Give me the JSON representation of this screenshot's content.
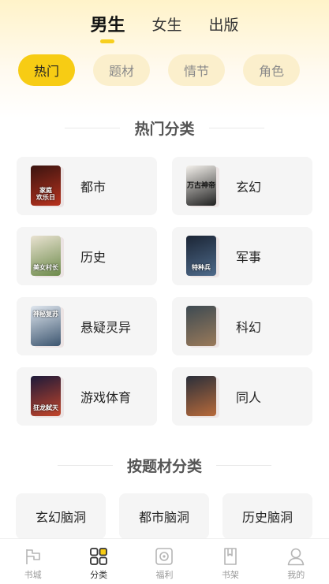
{
  "gender_tabs": [
    {
      "label": "男生",
      "active": true
    },
    {
      "label": "女生",
      "active": false
    },
    {
      "label": "出版",
      "active": false
    }
  ],
  "filter_chips": [
    {
      "label": "热门",
      "active": true
    },
    {
      "label": "题材",
      "active": false
    },
    {
      "label": "情节",
      "active": false
    },
    {
      "label": "角色",
      "active": false
    }
  ],
  "section_hot": {
    "title": "热门分类"
  },
  "categories": [
    {
      "label": "都市",
      "cover_text": "家庭\n欢乐日",
      "cover_colors": [
        "#3a1410",
        "#b8321e"
      ]
    },
    {
      "label": "玄幻",
      "cover_text": "万古神帝",
      "cover_colors": [
        "#f4f1ec",
        "#202020"
      ]
    },
    {
      "label": "历史",
      "cover_text": "美女村长",
      "cover_colors": [
        "#e9e2d1",
        "#6c8a4a"
      ]
    },
    {
      "label": "军事",
      "cover_text": "特种兵",
      "cover_colors": [
        "#1b2535",
        "#4e6a8a"
      ]
    },
    {
      "label": "悬疑灵异",
      "cover_text": "神秘复苏",
      "cover_colors": [
        "#dfe6ee",
        "#3d5670"
      ]
    },
    {
      "label": "科幻",
      "cover_text": "",
      "cover_colors": [
        "#3d4a52",
        "#9a7a5a"
      ]
    },
    {
      "label": "游戏体育",
      "cover_text": "狂龙弑天",
      "cover_colors": [
        "#1c1a3a",
        "#c4452a"
      ]
    },
    {
      "label": "同人",
      "cover_text": "",
      "cover_colors": [
        "#2a2f3a",
        "#b86a3a"
      ]
    }
  ],
  "section_topic": {
    "title": "按题材分类"
  },
  "topics": [
    {
      "label": "玄幻脑洞"
    },
    {
      "label": "都市脑洞"
    },
    {
      "label": "历史脑洞"
    }
  ],
  "bottom_nav": [
    {
      "label": "书城",
      "icon": "flag-icon",
      "active": false
    },
    {
      "label": "分类",
      "icon": "grid-icon",
      "active": true
    },
    {
      "label": "福利",
      "icon": "gift-icon",
      "active": false
    },
    {
      "label": "书架",
      "icon": "book-icon",
      "active": false
    },
    {
      "label": "我的",
      "icon": "user-icon",
      "active": false
    }
  ],
  "colors": {
    "accent": "#f7cc14",
    "chip_bg": "#fbefcc",
    "card_bg": "#f5f5f5"
  }
}
